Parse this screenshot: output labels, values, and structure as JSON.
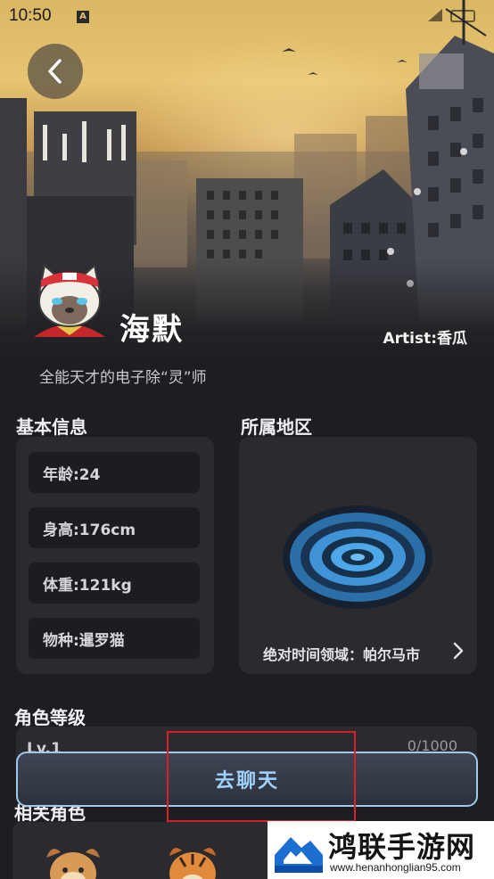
{
  "status_bar": {
    "time": "10:50",
    "notification_glyph": "A"
  },
  "header": {
    "back_icon": "chevron-left-icon"
  },
  "character": {
    "name": "海默",
    "artist": "Artist:香瓜",
    "tagline": "全能天才的电子除“灵”师"
  },
  "basic_info": {
    "title": "基本信息",
    "rows": [
      "年龄:24",
      "身高:176cm",
      "体重:121kg",
      "物种:暹罗猫"
    ]
  },
  "region": {
    "title": "所属地区",
    "name": "绝对时间领域：帕尔马市",
    "icon": "swirl-emblem-icon"
  },
  "level": {
    "title": "角色等级",
    "value": "Lv.1",
    "exp": "0/1000"
  },
  "related": {
    "title": "相关角色"
  },
  "chat_button": {
    "label": "去聊天"
  },
  "watermark": {
    "title": "鸿联手游网",
    "url": "www.henanhonglian95.com"
  },
  "colors": {
    "accent": "#9ed3ff",
    "highlight": "#d91f26",
    "card": "#2a2a2f",
    "background": "#1e1e22"
  }
}
